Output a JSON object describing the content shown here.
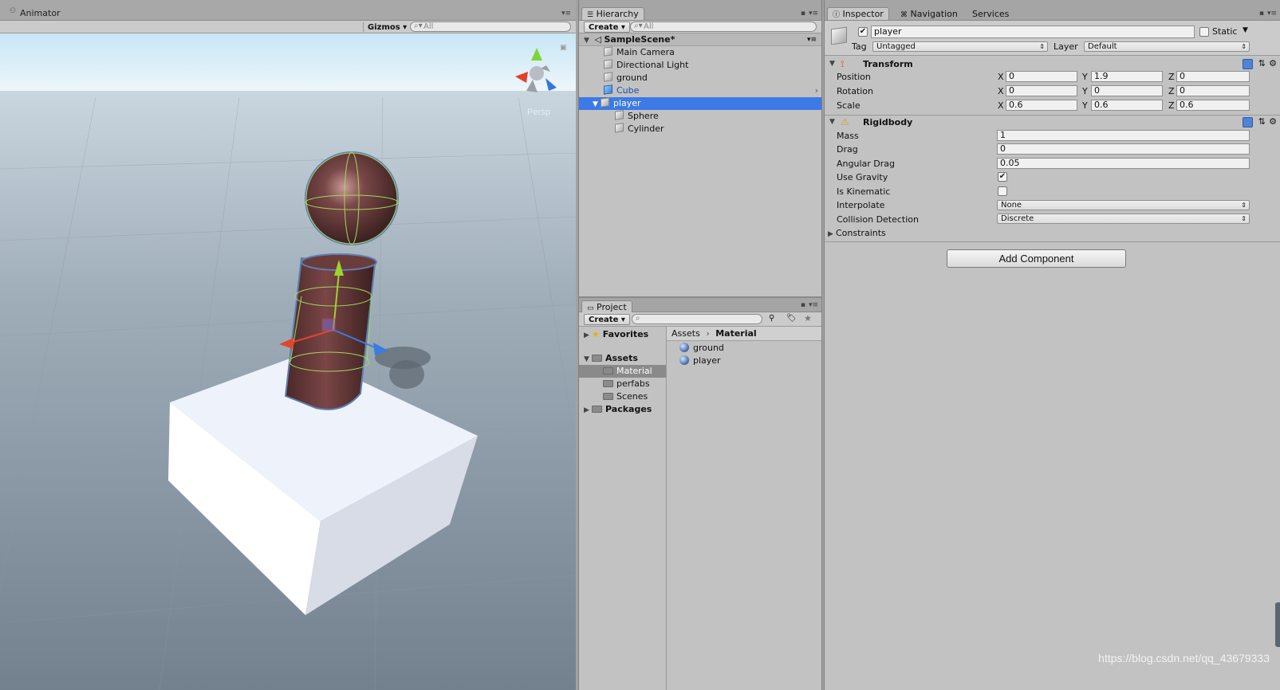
{
  "scene_view": {
    "tab_label": "Animator",
    "gizmos_label": "Gizmos",
    "search_placeholder": "All",
    "persp_label": "Persp"
  },
  "hierarchy": {
    "tab_label": "Hierarchy",
    "create_label": "Create",
    "search_placeholder": "All",
    "scene_name": "SampleScene*",
    "items": [
      {
        "label": "Main Camera"
      },
      {
        "label": "Directional Light"
      },
      {
        "label": "ground"
      },
      {
        "label": "Cube"
      },
      {
        "label": "player"
      },
      {
        "label": "Sphere"
      },
      {
        "label": "Cylinder"
      }
    ]
  },
  "project": {
    "tab_label": "Project",
    "create_label": "Create",
    "tree": {
      "favorites": "Favorites",
      "assets": "Assets",
      "folders": [
        "Material",
        "perfabs",
        "Scenes"
      ],
      "packages": "Packages"
    },
    "breadcrumb": {
      "root": "Assets",
      "current": "Material"
    },
    "files": [
      "ground",
      "player"
    ]
  },
  "inspector": {
    "tabs": [
      "Inspector",
      "Navigation",
      "Services"
    ],
    "object_name": "player",
    "static_label": "Static",
    "tag_label": "Tag",
    "tag_value": "Untagged",
    "layer_label": "Layer",
    "layer_value": "Default",
    "transform": {
      "title": "Transform",
      "position": {
        "label": "Position",
        "x": "0",
        "y": "1.9",
        "z": "0"
      },
      "rotation": {
        "label": "Rotation",
        "x": "0",
        "y": "0",
        "z": "0"
      },
      "scale": {
        "label": "Scale",
        "x": "0.6",
        "y": "0.6",
        "z": "0.6"
      }
    },
    "rigidbody": {
      "title": "Rigidbody",
      "mass_label": "Mass",
      "mass": "1",
      "drag_label": "Drag",
      "drag": "0",
      "angular_drag_label": "Angular Drag",
      "angular_drag": "0.05",
      "use_gravity_label": "Use Gravity",
      "use_gravity": true,
      "is_kinematic_label": "Is Kinematic",
      "is_kinematic": false,
      "interpolate_label": "Interpolate",
      "interpolate": "None",
      "collision_label": "Collision Detection",
      "collision": "Discrete",
      "constraints_label": "Constraints"
    },
    "add_component_label": "Add Component",
    "axis_labels": {
      "x": "X",
      "y": "Y",
      "z": "Z"
    }
  },
  "watermark": "https://blog.csdn.net/qq_43679333",
  "colors": {
    "selection": "#3d7ae6",
    "panel_bg": "#c2c2c2",
    "sky_top": "#c9e7f6",
    "ground": "#7b8a99"
  }
}
